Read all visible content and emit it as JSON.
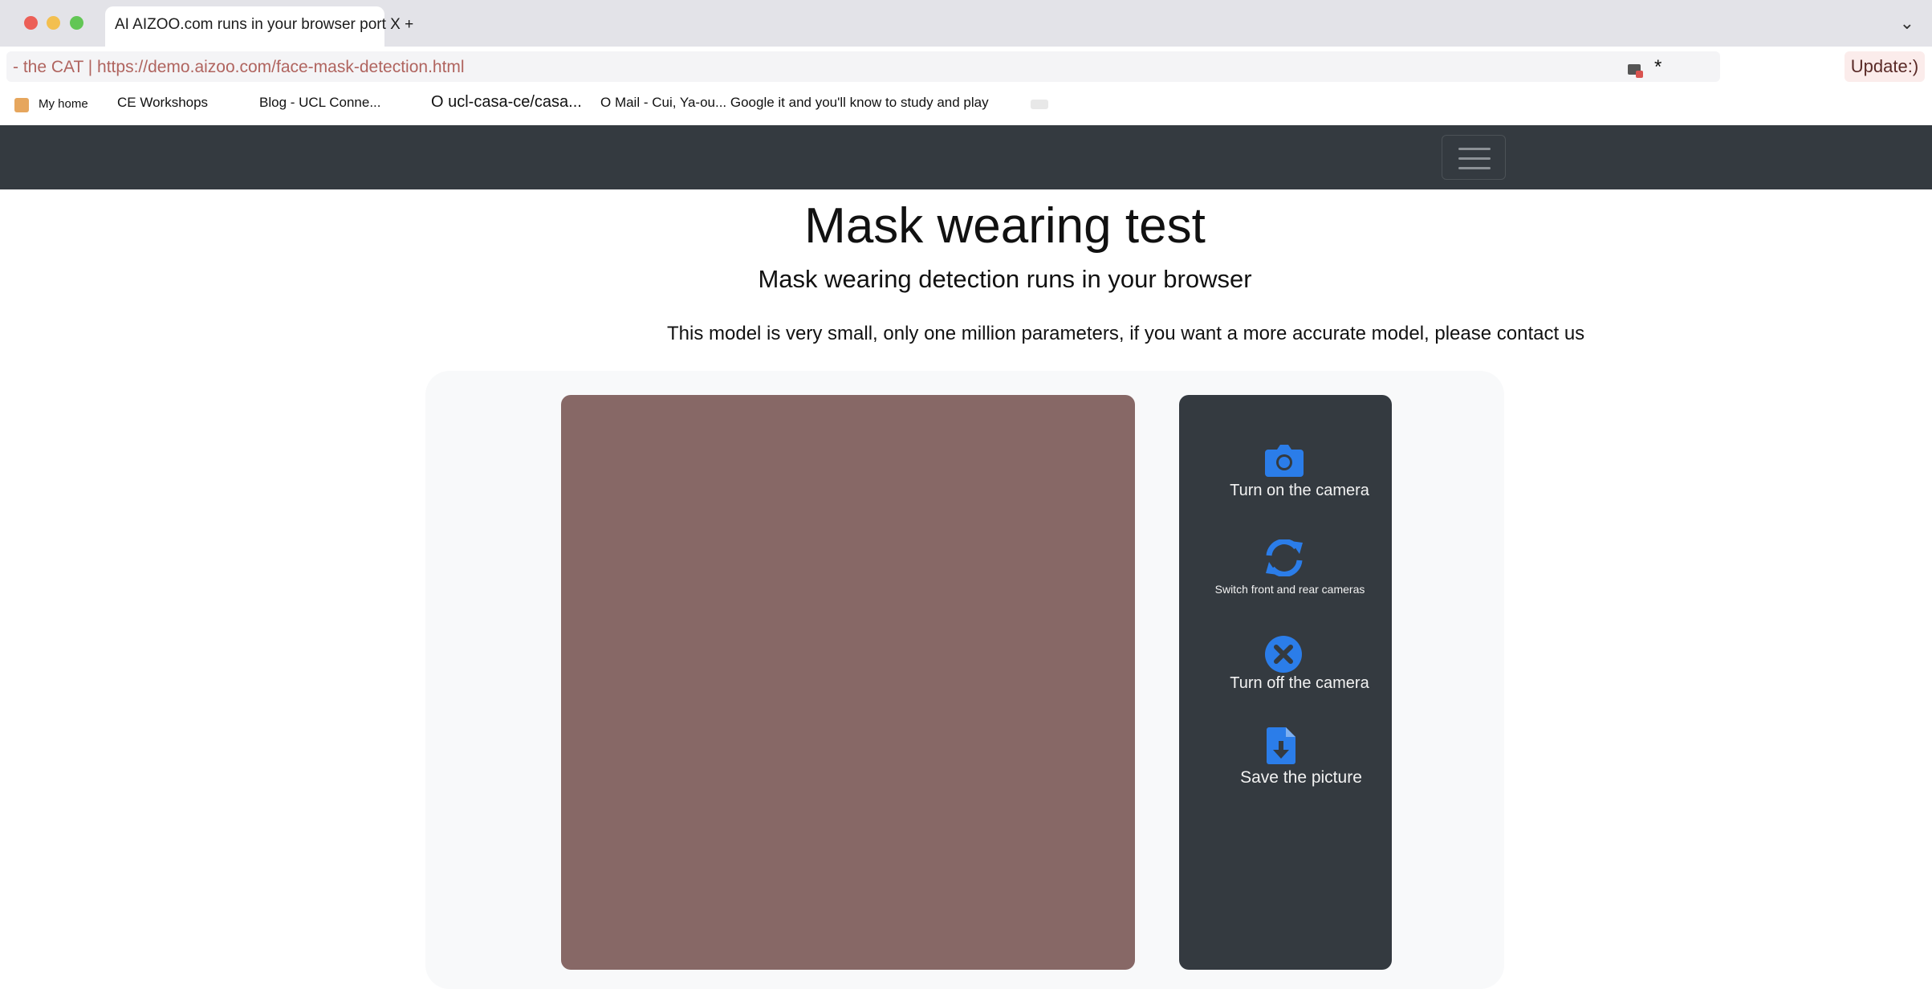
{
  "browser": {
    "tab_title": "AI AIZOO.com runs in your browser port X +",
    "url_prefix": "- the CAT | ",
    "url": "https://demo.aizoo.com/face-mask-detection.html",
    "update_label": "Update:)",
    "bookmarks": {
      "home": "My home",
      "ce": "CE Workshops",
      "blog": "Blog - UCL Conne...",
      "ucl": "O ucl-casa-ce/casa...",
      "mail": "O Mail - Cui, Ya-ou... Google it and you'll know to study and play"
    }
  },
  "page": {
    "title": "Mask wearing test",
    "subtitle": "Mask wearing detection runs in your browser",
    "description": "This model is very small, only one million parameters, if you want a more accurate model, please contact us"
  },
  "controls": {
    "camera_on": "Turn on the camera",
    "switch": "Switch front and rear cameras",
    "camera_off": "Turn off the camera",
    "save": "Save the picture"
  },
  "colors": {
    "accent": "#2b7de9",
    "navbar": "#343a40",
    "video_bg": "#876866"
  }
}
